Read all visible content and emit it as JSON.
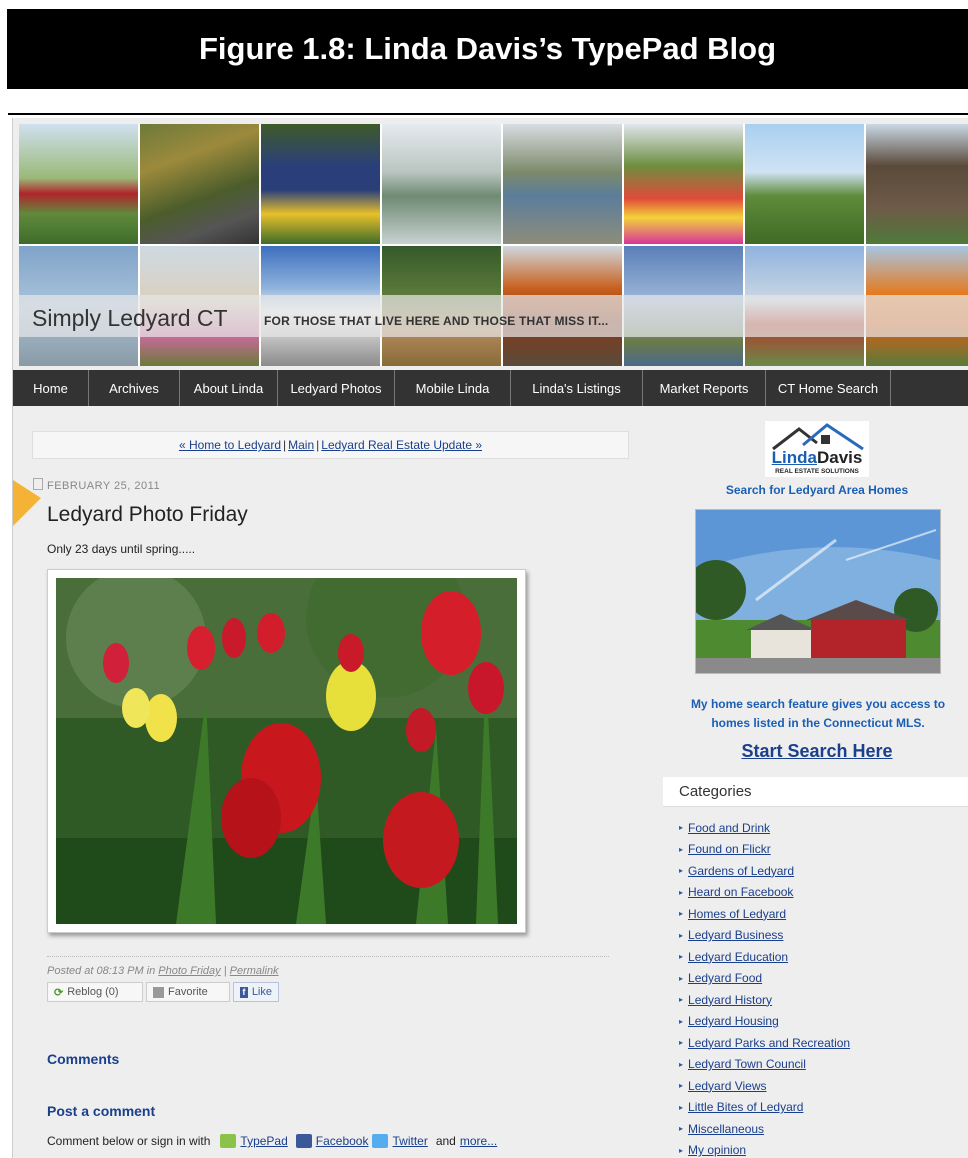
{
  "figure_caption": "Figure 1.8: Linda Davis’s TypePad Blog",
  "header": {
    "site_title": "Simply Ledyard CT",
    "tagline": "FOR THOSE THAT LIVE HERE AND THOSE THAT MISS IT..."
  },
  "nav": [
    "Home",
    "Archives",
    "About Linda",
    "Ledyard Photos",
    "Mobile Linda",
    "Linda's Listings",
    "Market Reports",
    "CT Home Search"
  ],
  "post_nav": {
    "prev": "« Home to Ledyard",
    "main": "Main",
    "next": "Ledyard Real Estate Update »",
    "sep": "|"
  },
  "post": {
    "date": "FEBRUARY 25, 2011",
    "title": "Ledyard Photo Friday",
    "body": "Only 23 days until spring.....",
    "posted_prefix": "Posted at 08:13 PM in",
    "category_link": "Photo Friday",
    "sep": "|",
    "permalink": "Permalink"
  },
  "buttons": {
    "reblog": "Reblog (0)",
    "favorite": "Favorite",
    "like": "Like"
  },
  "comments": {
    "heading": "Comments",
    "post_heading": "Post a comment",
    "signin_prefix": "Comment below or sign in with",
    "typepad": "TypePad",
    "facebook": "Facebook",
    "twitter": "Twitter",
    "and": "and",
    "more": "more..."
  },
  "sidebar": {
    "logo_text_1": "Linda",
    "logo_text_2": "Davis",
    "logo_sub": "REAL ESTATE SOLUTIONS",
    "search_link": "Search for Ledyard Area Homes",
    "promo": "My home search feature gives you access to homes listed in the Connecticut MLS.",
    "cta": "Start Search Here",
    "categories_heading": "Categories",
    "categories": [
      "Food and Drink",
      "Found on Flickr",
      "Gardens of Ledyard",
      "Heard on Facebook",
      "Homes of Ledyard",
      "Ledyard Business",
      "Ledyard Education",
      "Ledyard Food",
      "Ledyard History",
      "Ledyard Housing",
      "Ledyard Parks and Recreation",
      "Ledyard Town Council",
      "Ledyard Views",
      "Little Bites of Ledyard",
      "Miscellaneous",
      "My opinion"
    ]
  },
  "colors": {
    "nav_bg": "#333333",
    "link": "#1a3f8c",
    "accent_blue": "#1a5fb4",
    "arrow": "#f5b335"
  }
}
